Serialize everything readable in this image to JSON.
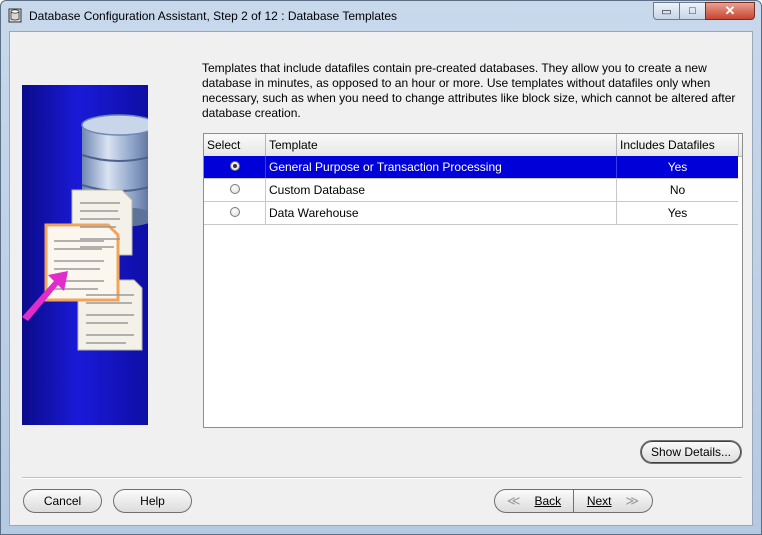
{
  "window": {
    "title": "Database Configuration Assistant, Step 2 of 12 : Database Templates",
    "icon": "database-app-icon"
  },
  "controls": {
    "minimize": "▭",
    "maximize": "□",
    "close": "✕"
  },
  "description": "Templates that include datafiles contain pre-created databases. They allow you to create a new database in minutes, as opposed to an hour or more. Use templates without datafiles only when necessary, such as when you need to change attributes like block size, which cannot be altered after database creation.",
  "table": {
    "columns": [
      "Select",
      "Template",
      "Includes Datafiles"
    ],
    "rows": [
      {
        "template": "General Purpose or Transaction Processing",
        "includes": "Yes",
        "selected": true
      },
      {
        "template": "Custom Database",
        "includes": "No",
        "selected": false
      },
      {
        "template": "Data Warehouse",
        "includes": "Yes",
        "selected": false
      }
    ]
  },
  "buttons": {
    "show_details": "Show Details...",
    "cancel": "Cancel",
    "help": "Help",
    "back": "Back",
    "next": "Next",
    "back_chevron": "≪",
    "next_chevron": "≫"
  },
  "colors": {
    "selection": "#0000d8",
    "illustration": "#1a1ad8",
    "arrow": "#e02cc8"
  }
}
